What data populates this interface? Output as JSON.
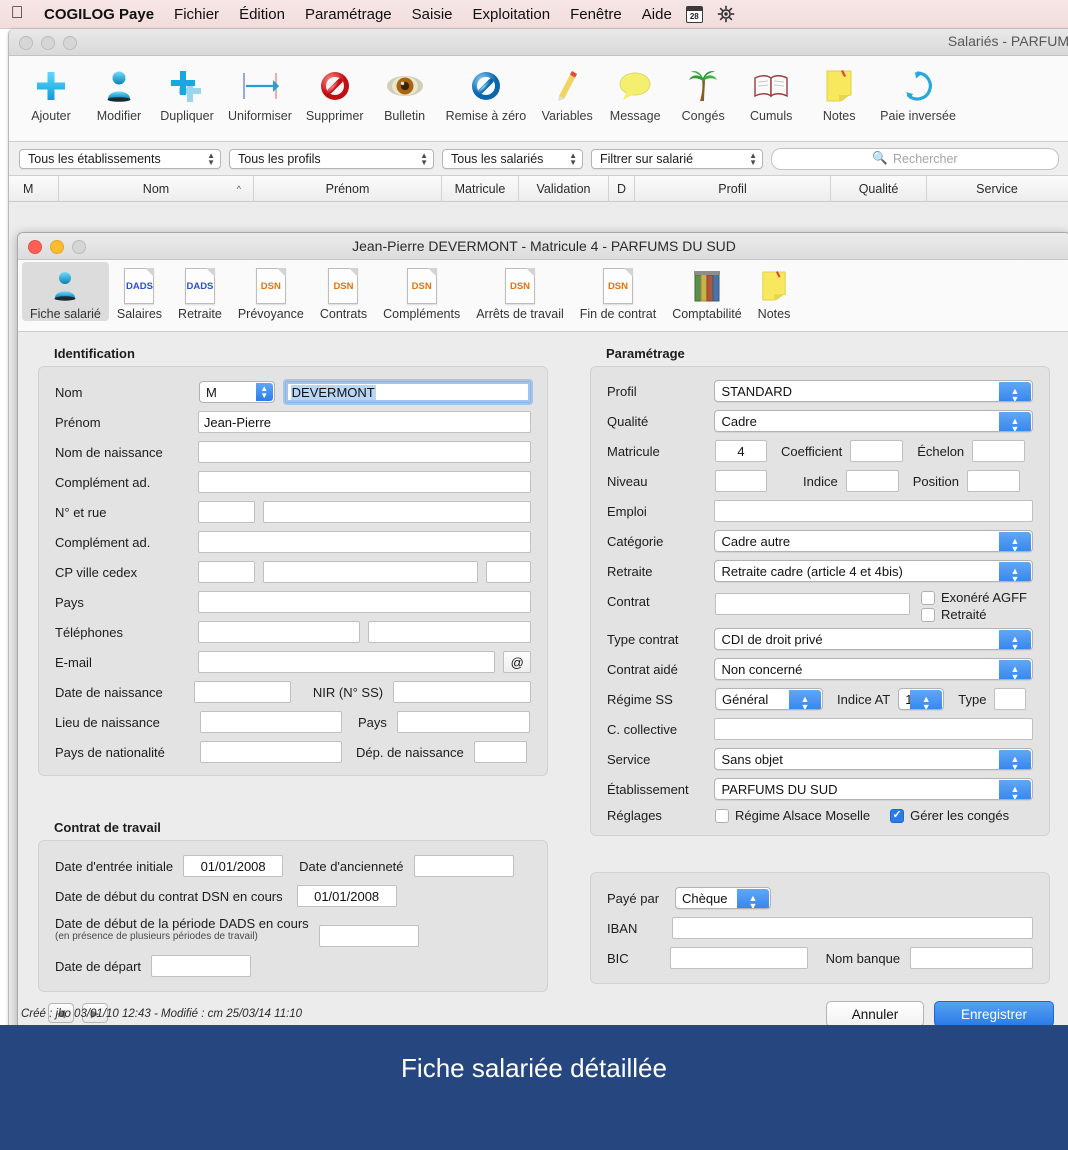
{
  "menubar": {
    "apple_icon": "apple-logo",
    "app_name": "COGILOG Paye",
    "items": [
      "Fichier",
      "Édition",
      "Paramétrage",
      "Saisie",
      "Exploitation",
      "Fenêtre",
      "Aide"
    ],
    "calendar_icon_day": "28",
    "extra_icon": "gear-icon"
  },
  "outer_window": {
    "title": "Salariés - PARFUM",
    "toolbar": [
      {
        "label": "Ajouter",
        "icon": "plus-icon"
      },
      {
        "label": "Modifier",
        "icon": "person-icon"
      },
      {
        "label": "Dupliquer",
        "icon": "duplicate-plus-icon"
      },
      {
        "label": "Uniformiser",
        "icon": "arrow-to-line-icon"
      },
      {
        "label": "Supprimer",
        "icon": "forbidden-red-icon"
      },
      {
        "label": "Bulletin",
        "icon": "eye-icon"
      },
      {
        "label": "Remise à zéro",
        "icon": "forbidden-blue-icon"
      },
      {
        "label": "Variables",
        "icon": "pencil-icon"
      },
      {
        "label": "Message",
        "icon": "speech-bubble-icon"
      },
      {
        "label": "Congés",
        "icon": "palm-tree-icon"
      },
      {
        "label": "Cumuls",
        "icon": "open-book-icon"
      },
      {
        "label": "Notes",
        "icon": "sticky-note-icon"
      },
      {
        "label": "Paie inversée",
        "icon": "refresh-circle-icon"
      }
    ],
    "filters": [
      {
        "name": "establishment",
        "value": "Tous les établissements"
      },
      {
        "name": "profile",
        "value": "Tous les profils"
      },
      {
        "name": "employees",
        "value": "Tous les salariés"
      },
      {
        "name": "filter-on",
        "value": "Filtrer sur salarié"
      }
    ],
    "search_placeholder": "Rechercher",
    "columns": [
      "M",
      "Nom",
      "Prénom",
      "Matricule",
      "Validation",
      "D",
      "Profil",
      "Qualité",
      "Service"
    ],
    "sort_indicator": "^"
  },
  "inner_window": {
    "title": "Jean-Pierre DEVERMONT - Matricule 4 - PARFUMS DU SUD",
    "tabs": [
      {
        "label": "Fiche salarié",
        "icon": "person-icon",
        "kind": "person",
        "active": true
      },
      {
        "label": "Salaires",
        "icon": "dads-doc-icon",
        "kind": "DADS",
        "active": false
      },
      {
        "label": "Retraite",
        "icon": "dads-doc-icon",
        "kind": "DADS",
        "active": false
      },
      {
        "label": "Prévoyance",
        "icon": "dsn-doc-icon",
        "kind": "DSN",
        "active": false
      },
      {
        "label": "Contrats",
        "icon": "dsn-doc-icon",
        "kind": "DSN",
        "active": false
      },
      {
        "label": "Compléments",
        "icon": "dsn-doc-icon",
        "kind": "DSN",
        "active": false
      },
      {
        "label": "Arrêts de travail",
        "icon": "dsn-doc-icon",
        "kind": "DSN",
        "active": false
      },
      {
        "label": "Fin de contrat",
        "icon": "dsn-doc-icon",
        "kind": "DSN",
        "active": false
      },
      {
        "label": "Comptabilité",
        "icon": "books-icon",
        "kind": "books",
        "active": false
      },
      {
        "label": "Notes",
        "icon": "sticky-note-icon",
        "kind": "note",
        "active": false
      }
    ]
  },
  "identification": {
    "title": "Identification",
    "civility": {
      "label": "Nom",
      "value": "M"
    },
    "last_name": {
      "value": "DEVERMONT",
      "selected": true
    },
    "fields": [
      {
        "label": "Prénom",
        "value": "Jean-Pierre"
      },
      {
        "label": "Nom de naissance",
        "value": ""
      },
      {
        "label": "Complément ad.",
        "value": ""
      }
    ],
    "street_label": "N° et rue",
    "street_num": "",
    "street_name": "",
    "complement2_label": "Complément ad.",
    "complement2": "",
    "cp_label": "CP ville cedex",
    "cp": "",
    "city": "",
    "cedex": "",
    "country_label": "Pays",
    "country": "",
    "phones_label": "Téléphones",
    "phone1": "",
    "phone2": "",
    "email_label": "E-mail",
    "email": "",
    "email_btn": "@",
    "birth_date_label": "Date de naissance",
    "birth_date": "",
    "nir_label": "NIR (N° SS)",
    "nir": "",
    "birth_place_label": "Lieu de naissance",
    "birth_place": "",
    "birth_country_label": "Pays",
    "birth_country": "",
    "nationality_label": "Pays de nationalité",
    "nationality": "",
    "birth_dept_label": "Dép. de naissance",
    "birth_dept": ""
  },
  "contrat_travail": {
    "title": "Contrat de travail",
    "entry_date_label": "Date d'entrée initiale",
    "entry_date": "01/01/2008",
    "seniority_label": "Date d'ancienneté",
    "seniority": "",
    "dsn_start_label": "Date de début du contrat DSN en cours",
    "dsn_start": "01/01/2008",
    "dads_start_label": "Date de début de la période DADS en cours",
    "dads_start_hint": "(en présence de plusieurs périodes de travail)",
    "dads_start": "",
    "departure_label": "Date de départ",
    "departure": ""
  },
  "parametrage": {
    "title": "Paramétrage",
    "profil_label": "Profil",
    "profil": "STANDARD",
    "qualite_label": "Qualité",
    "qualite": "Cadre",
    "matricule_label": "Matricule",
    "matricule": "4",
    "coefficient_label": "Coefficient",
    "coefficient": "",
    "echelon_label": "Échelon",
    "echelon": "",
    "niveau_label": "Niveau",
    "niveau": "",
    "indice_label": "Indice",
    "indice": "",
    "position_label": "Position",
    "position": "",
    "emploi_label": "Emploi",
    "emploi": "",
    "categorie_label": "Catégorie",
    "categorie": "Cadre autre",
    "retraite_label": "Retraite",
    "retraite": "Retraite cadre (article 4 et 4bis)",
    "contrat_label": "Contrat",
    "contrat": "",
    "exonere_agff_label": "Exonéré AGFF",
    "exonere_agff": false,
    "retraite_chk_label": "Retraité",
    "retraite_chk": false,
    "type_contrat_label": "Type contrat",
    "type_contrat": "CDI de droit privé",
    "contrat_aide_label": "Contrat aidé",
    "contrat_aide": "Non concerné",
    "regime_ss_label": "Régime SS",
    "regime_ss": "Général",
    "indice_at_label": "Indice AT",
    "indice_at": "1",
    "type_label": "Type",
    "type": "",
    "c_collective_label": "C. collective",
    "c_collective": "",
    "service_label": "Service",
    "service": "Sans objet",
    "etablissement_label": "Établissement",
    "etablissement": "PARFUMS DU SUD",
    "reglages_label": "Réglages",
    "alsace_label": "Régime Alsace Moselle",
    "alsace": false,
    "conges_label": "Gérer les congés",
    "conges": true
  },
  "paiement": {
    "paye_par_label": "Payé par",
    "paye_par": "Chèque",
    "iban_label": "IBAN",
    "iban": "",
    "bic_label": "BIC",
    "bic": "",
    "nom_banque_label": "Nom banque",
    "nom_banque": ""
  },
  "footer": {
    "prev_arrow": "◀",
    "next_arrow": "▶",
    "cancel_label": "Annuler",
    "save_label": "Enregistrer",
    "meta": "Créé : jbo 03/01/10 12:43 - Modifié : cm 25/03/14 11:10"
  },
  "caption": {
    "text": "Fiche salariée détaillée",
    "bg_color": "#26467f"
  }
}
